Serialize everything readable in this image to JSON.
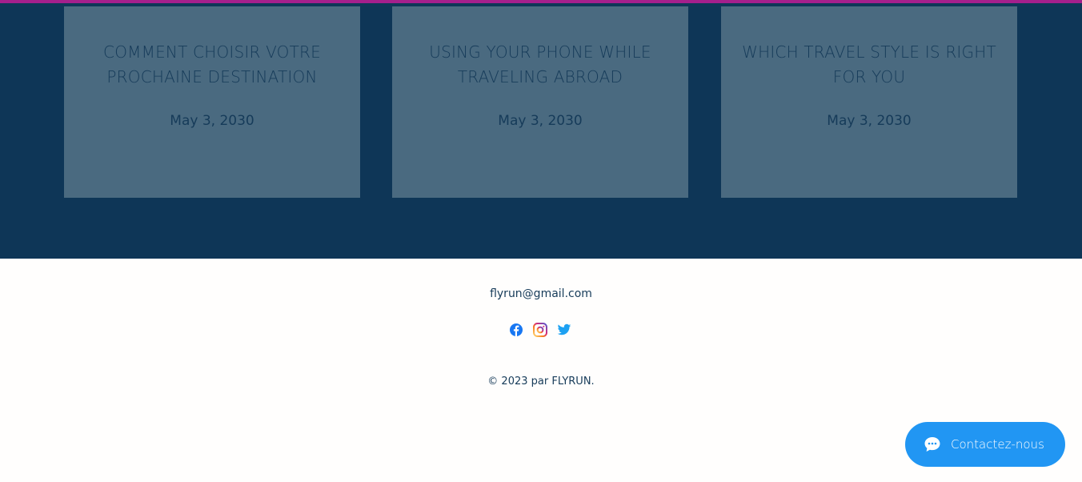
{
  "accent_colors": {
    "top_strip": "#a51f8c",
    "blog_band": "#0e3657",
    "card": "#4a6a80",
    "card_text": "#163b59",
    "contact_button": "#2196f3"
  },
  "blog": {
    "posts": [
      {
        "title": "COMMENT CHOISIR VOTRE PROCHAINE DESTINATION",
        "date": "May 3, 2030"
      },
      {
        "title": "USING YOUR PHONE WHILE TRAVELING ABROAD",
        "date": "May 3, 2030"
      },
      {
        "title": "WHICH TRAVEL STYLE IS RIGHT FOR YOU",
        "date": "May 3, 2030"
      }
    ]
  },
  "footer": {
    "email": "flyrun@gmail.com",
    "social": [
      {
        "icon": "facebook-icon",
        "color": "#1877f2"
      },
      {
        "icon": "instagram-icon",
        "color": "#d62976"
      },
      {
        "icon": "twitter-icon",
        "color": "#1da1f2"
      }
    ],
    "copyright": "© 2023 par FLYRUN."
  },
  "chat": {
    "label": "Contactez-nous",
    "icon": "chat-bubble-icon"
  }
}
